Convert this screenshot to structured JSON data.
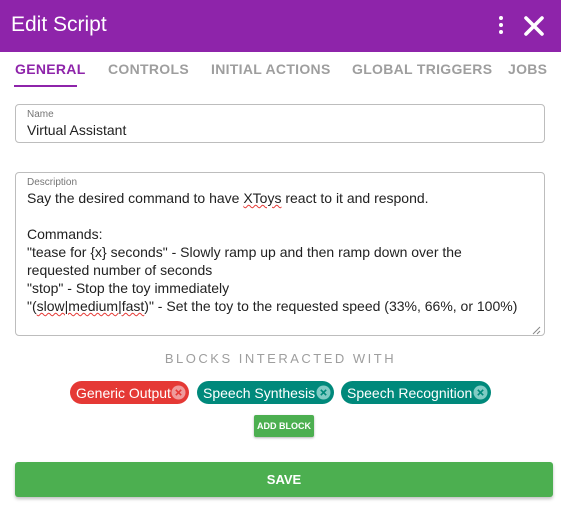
{
  "dialog": {
    "title": "Edit Script",
    "header_color": "#8e24aa",
    "icons": {
      "menu": "more-vert-icon",
      "close": "close-icon"
    }
  },
  "tabs": [
    {
      "label": "GENERAL",
      "active": true
    },
    {
      "label": "CONTROLS",
      "active": false
    },
    {
      "label": "INITIAL ACTIONS",
      "active": false
    },
    {
      "label": "GLOBAL TRIGGERS",
      "active": false
    },
    {
      "label": "JOBS",
      "active": false
    }
  ],
  "name_field": {
    "label": "Name",
    "value": "Virtual Assistant"
  },
  "description_field": {
    "label": "Description",
    "lines": {
      "l1_a": "Say the desired command to have ",
      "l1_b": "XToys",
      "l1_c": " react to it and respond.",
      "l3": "Commands:",
      "l4": "\"tease for {x} seconds\" - Slowly ramp up and then ramp down over the",
      "l5": "requested number of seconds",
      "l6": "\"stop\" - Stop the toy immediately",
      "l7_a": "\"(",
      "l7_b": "slow|medium|fast",
      "l7_c": ")\" - Set the toy to the requested speed (33%, 66%, or 100%)"
    }
  },
  "blocks": {
    "heading": "BLOCKS INTERACTED WITH",
    "chips": [
      {
        "label": "Generic Output",
        "color": "#e53935"
      },
      {
        "label": "Speech Synthesis",
        "color": "#00897b"
      },
      {
        "label": "Speech Recognition",
        "color": "#00897b"
      }
    ],
    "add_label": "ADD BLOCK"
  },
  "save_label": "SAVE",
  "colors": {
    "accent": "#8e24aa",
    "green": "#4caf50",
    "red": "#e53935",
    "teal": "#00897b"
  }
}
